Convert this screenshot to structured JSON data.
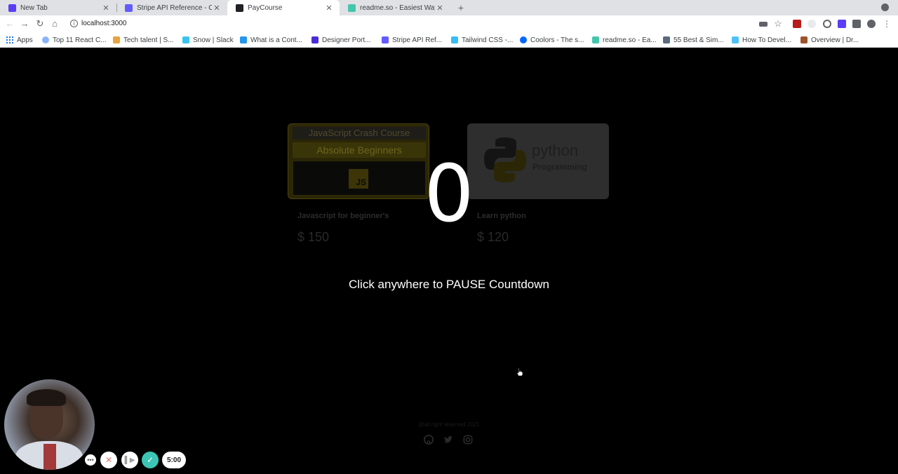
{
  "browser": {
    "tabs": [
      {
        "title": "New Tab",
        "color": "#5b3df5"
      },
      {
        "title": "Stripe API Reference - Cre",
        "color": "#635bff"
      },
      {
        "title": "PayCourse",
        "color": "#202124"
      },
      {
        "title": "readme.so - Easiest Way t",
        "color": "#43c6ac"
      }
    ],
    "active_tab": 2,
    "url": "localhost:3000",
    "bookmarks": [
      {
        "label": "Apps"
      },
      {
        "label": "Top 11 React C...",
        "color": "#8ab4f8"
      },
      {
        "label": "Tech talent | S...",
        "color": "#e8a33d"
      },
      {
        "label": "Snow | Slack",
        "color": "#36c5f0"
      },
      {
        "label": "What is a Cont...",
        "color": "#2496ed"
      },
      {
        "label": "Designer Port...",
        "color": "#4b2bd8"
      },
      {
        "label": "Stripe API Ref...",
        "color": "#635bff"
      },
      {
        "label": "Tailwind CSS -...",
        "color": "#38bdf8"
      },
      {
        "label": "Coolors - The s...",
        "color": "#0066ff"
      },
      {
        "label": "readme.so - Ea...",
        "color": "#43c6ac"
      },
      {
        "label": "55 Best & Sim...",
        "color": "#5a6b7d"
      },
      {
        "label": "How To Devel...",
        "color": "#4fc3f7"
      },
      {
        "label": "Overview | Dr...",
        "color": "#a0522d"
      }
    ]
  },
  "page": {
    "courses": [
      {
        "title": "Javascript for beginner's",
        "price": "$ 150",
        "thumb_line1": "JavaScript Crash Course",
        "thumb_line2": "Absolute Beginners",
        "thumb_logo": "JS"
      },
      {
        "title": "Learn python",
        "price": "$ 120",
        "thumb_word": "python",
        "thumb_sub": "Programming"
      }
    ],
    "countdown": "0",
    "pause_message": "Click anywhere to PAUSE Countdown",
    "footer": "@all right reserved 2021",
    "social_icons": [
      "github-icon",
      "twitter-icon",
      "instagram-icon"
    ]
  },
  "recorder": {
    "timer": "5:00",
    "accent": "#3cc5b5"
  }
}
